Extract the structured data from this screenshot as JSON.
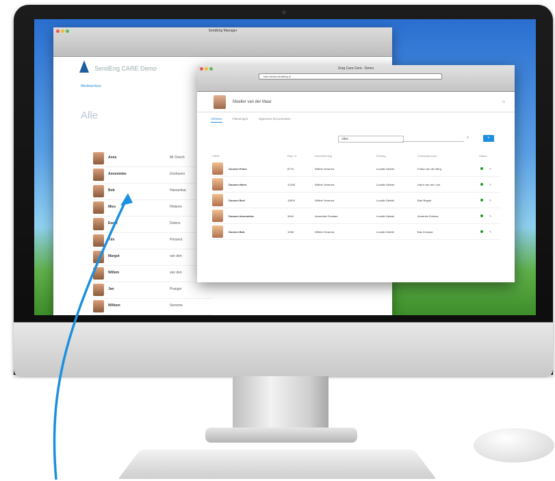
{
  "back_window": {
    "title": "SendEng Manager",
    "brand": "SendEng CARE Demo",
    "tab": "Medewerkers",
    "heading": "Alle",
    "people": [
      {
        "name": "Anne",
        "city": "Mr Dench"
      },
      {
        "name": "Annemieke",
        "city": "Zonhaven"
      },
      {
        "name": "Bob",
        "city": "Hansenkai"
      },
      {
        "name": "Mies",
        "city": "Hinterre"
      },
      {
        "name": "Ewart",
        "city": "Dolens"
      },
      {
        "name": "Kim",
        "city": "Prinsent"
      },
      {
        "name": "Margot",
        "city": "van den"
      },
      {
        "name": "Willem",
        "city": "van den"
      },
      {
        "name": "Jan",
        "city": "Pranger"
      },
      {
        "name": "Wilhem",
        "city": "Verreme"
      }
    ]
  },
  "front_window": {
    "title": "Zorg Care Cent - Demo",
    "url": "care-demo.sendeng.nl",
    "profile_name": "Moeller van der Maar",
    "tabs": [
      "Cliënten",
      "Planningen",
      "Algemene Documenten"
    ],
    "filter_value": "Alles",
    "add_label": "+",
    "headers": [
      "Cliënt",
      "Reg. nr.",
      "Adres/Woning",
      "Woning",
      "Contactpersoon",
      "Status"
    ],
    "rows": [
      {
        "name": "Dooeen Frans",
        "reg": "8773",
        "addr": "Willem Verarma",
        "home": "Luxalle Zaterle",
        "contact": "Fokko van der Berg"
      },
      {
        "name": "Dooeen Harm",
        "reg": "12440",
        "addr": "Willem Verarma",
        "home": "Luxalle Zaterle",
        "contact": "Harm van der Lust"
      },
      {
        "name": "Dooeen Bert",
        "reg": "11894",
        "addr": "Willem Verarma",
        "home": "Luxalle Zaterle",
        "contact": "Bart Bogart"
      },
      {
        "name": "Dooeen Annemieke",
        "reg": "3944",
        "addr": "Annemiek Zomaan",
        "home": "Luxalle Zaterle",
        "contact": "Annemie Zolarna"
      },
      {
        "name": "Dooeen Bob",
        "reg": "1338",
        "addr": "Willem Verarma",
        "home": "Luxalle Zaterle",
        "contact": "Bas Zomaan"
      }
    ]
  },
  "colors": {
    "accent": "#1d8ee0",
    "status_ok": "#1a9a2a",
    "arrow": "#1b8fe0"
  }
}
